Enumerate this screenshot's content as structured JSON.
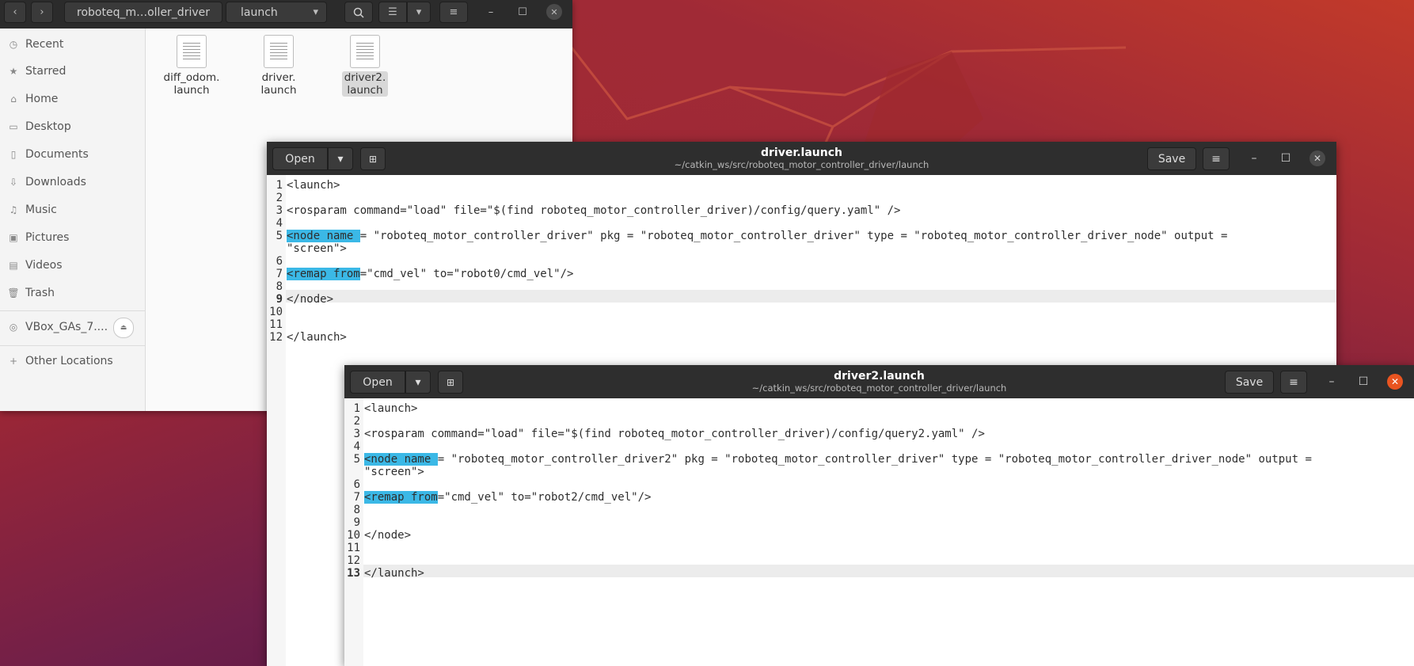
{
  "files": {
    "path_segments": [
      "roboteq_m…oller_driver",
      "launch"
    ],
    "sidebar": [
      {
        "icon": "clock-icon",
        "label": "Recent"
      },
      {
        "icon": "star-icon",
        "label": "Starred"
      },
      {
        "icon": "home-icon",
        "label": "Home"
      },
      {
        "icon": "desktop-icon",
        "label": "Desktop"
      },
      {
        "icon": "documents-icon",
        "label": "Documents"
      },
      {
        "icon": "downloads-icon",
        "label": "Downloads"
      },
      {
        "icon": "music-icon",
        "label": "Music"
      },
      {
        "icon": "pictures-icon",
        "label": "Pictures"
      },
      {
        "icon": "videos-icon",
        "label": "Videos"
      },
      {
        "icon": "trash-icon",
        "label": "Trash"
      }
    ],
    "device": {
      "icon": "disc-icon",
      "label": "VBox_GAs_7...."
    },
    "other": {
      "icon": "plus-icon",
      "label": "Other Locations"
    },
    "items": [
      {
        "name1": "diff_odom.",
        "name2": "launch"
      },
      {
        "name1": "driver.",
        "name2": "launch"
      },
      {
        "name1": "driver2.",
        "name2": "launch"
      }
    ]
  },
  "editor1": {
    "open_label": "Open",
    "save_label": "Save",
    "title": "driver.launch",
    "subtitle": "~/catkin_ws/src/roboteq_motor_controller_driver/launch",
    "line_numbers": [
      "1",
      "2",
      "3",
      "4",
      "5",
      "",
      "6",
      "7",
      "8",
      "9",
      "10",
      "11",
      "12"
    ],
    "lines": [
      {
        "pre": "<launch>"
      },
      {
        "pre": ""
      },
      {
        "pre": "<rosparam command=\"load\" file=\"$(find roboteq_motor_controller_driver)/config/query.yaml\" />"
      },
      {
        "pre": ""
      },
      {
        "hl": "<node name ",
        "pre": "= \"roboteq_motor_controller_driver\" pkg = \"roboteq_motor_controller_driver\" type = \"roboteq_motor_controller_driver_node\" output ="
      },
      {
        "pre": "\"screen\">"
      },
      {
        "pre": ""
      },
      {
        "hl": "<remap from",
        "pre": "=\"cmd_vel\" to=\"robot0/cmd_vel\"/>"
      },
      {
        "pre": ""
      },
      {
        "pre": "</node>"
      },
      {
        "pre": ""
      },
      {
        "pre": ""
      },
      {
        "pre": "</launch>"
      }
    ]
  },
  "editor2": {
    "open_label": "Open",
    "save_label": "Save",
    "title": "driver2.launch",
    "subtitle": "~/catkin_ws/src/roboteq_motor_controller_driver/launch",
    "line_numbers": [
      "1",
      "2",
      "3",
      "4",
      "5",
      "",
      "6",
      "7",
      "8",
      "9",
      "10",
      "11",
      "12",
      "13"
    ],
    "lines": [
      {
        "pre": "<launch>"
      },
      {
        "pre": ""
      },
      {
        "pre": "<rosparam command=\"load\" file=\"$(find roboteq_motor_controller_driver)/config/query2.yaml\" />"
      },
      {
        "pre": ""
      },
      {
        "hl": "<node name ",
        "pre": "= \"roboteq_motor_controller_driver2\" pkg = \"roboteq_motor_controller_driver\" type = \"roboteq_motor_controller_driver_node\" output ="
      },
      {
        "pre": "\"screen\">"
      },
      {
        "pre": ""
      },
      {
        "hl": "<remap from",
        "pre": "=\"cmd_vel\" to=\"robot2/cmd_vel\"/>"
      },
      {
        "pre": ""
      },
      {
        "pre": ""
      },
      {
        "pre": "</node>"
      },
      {
        "pre": ""
      },
      {
        "pre": ""
      },
      {
        "pre": "</launch>"
      }
    ]
  }
}
